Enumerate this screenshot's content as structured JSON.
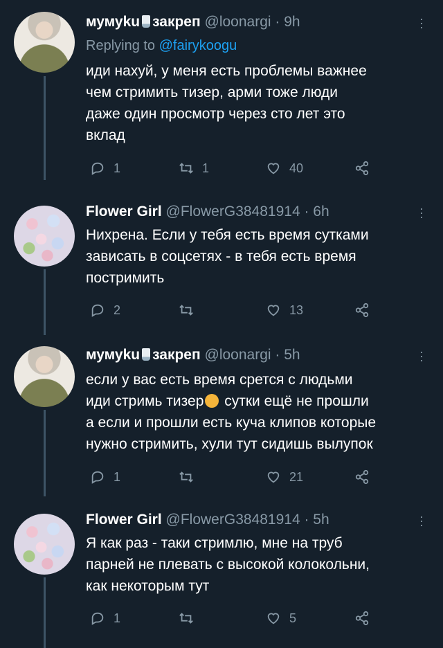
{
  "tweets": [
    {
      "name": "мумуku",
      "name_suffix": "закреп",
      "handle": "@loonargi",
      "time": "· 9h",
      "replying_prefix": "Replying to",
      "replying_to": "@fairykoogu",
      "lines": [
        "иди нахуй, у меня есть проблемы важнее",
        "чем стримить тизер, арми тоже люди",
        "даже один просмотр через сто лет это",
        "вклад"
      ],
      "replies": "1",
      "retweets": "1",
      "likes": "40"
    },
    {
      "name": "Flower Girl",
      "handle": "@FlowerG38481914",
      "time": "· 6h",
      "lines": [
        "Нихрена. Если у тебя есть время сутками",
        "зависать в соцсетях - в тебя есть время",
        "постримить"
      ],
      "replies": "2",
      "retweets": "",
      "likes": "13"
    },
    {
      "name": "мумуku",
      "name_suffix": "закреп",
      "handle": "@loonargi",
      "time": "· 5h",
      "lines": [
        "если у вас есть время срется с людьми",
        "иди стримь тизер",
        " сутки ещё не прошли",
        "а если и прошли есть куча клипов которые",
        "нужно стримить, хули тут сидишь вылупок"
      ],
      "replies": "1",
      "retweets": "",
      "likes": "21"
    },
    {
      "name": "Flower Girl",
      "handle": "@FlowerG38481914",
      "time": "· 5h",
      "lines": [
        "Я как раз - таки  стримлю, мне на труб",
        "парней не плевать с высокой колокольни,",
        "как некоторым тут"
      ],
      "replies": "1",
      "retweets": "",
      "likes": "5"
    }
  ],
  "colors": {
    "background": "#15202b",
    "text": "#ffffff",
    "secondary": "#8899a6",
    "link": "#1da1f2",
    "thread_line": "#3d5466"
  },
  "icons": [
    "reply-icon",
    "retweet-icon",
    "like-icon",
    "share-icon",
    "more-icon",
    "milk-emoji-icon",
    "blush-emoji-icon"
  ]
}
